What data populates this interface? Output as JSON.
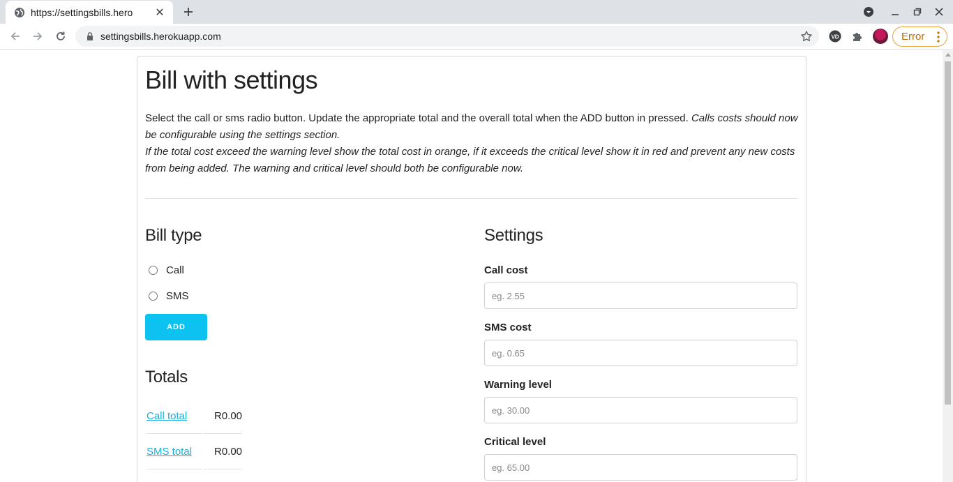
{
  "browser": {
    "tab_title": "https://settingsbills.hero",
    "url": "settingsbills.herokuapp.com",
    "error_label": "Error"
  },
  "page": {
    "title": "Bill with settings",
    "intro_plain": "Select the call or sms radio button. Update the appropriate total and the overall total when the ADD button in pressed. ",
    "intro_italic_1": "Calls costs should now be configurable using the settings section.",
    "intro_italic_2": "If the total cost exceed the warning level show the total cost in orange, if it exceeds the critical level show it in red and prevent any new costs from being added. The warning and critical level should both be configurable now."
  },
  "bill_type": {
    "heading": "Bill type",
    "options": [
      {
        "label": "Call",
        "selected": false
      },
      {
        "label": "SMS",
        "selected": false
      }
    ],
    "add_label": "ADD"
  },
  "totals": {
    "heading": "Totals",
    "rows": [
      {
        "label": "Call total",
        "value": "R0.00"
      },
      {
        "label": "SMS total",
        "value": "R0.00"
      }
    ]
  },
  "settings": {
    "heading": "Settings",
    "fields": [
      {
        "label": "Call cost",
        "placeholder": "eg. 2.55",
        "value": ""
      },
      {
        "label": "SMS cost",
        "placeholder": "eg. 0.65",
        "value": ""
      },
      {
        "label": "Warning level",
        "placeholder": "eg. 30.00",
        "value": ""
      },
      {
        "label": "Critical level",
        "placeholder": "eg. 65.00",
        "value": ""
      }
    ]
  },
  "colors": {
    "accent_button": "#0cc2f0",
    "link": "#1eaedb",
    "error_pill": "#e8a33d"
  }
}
